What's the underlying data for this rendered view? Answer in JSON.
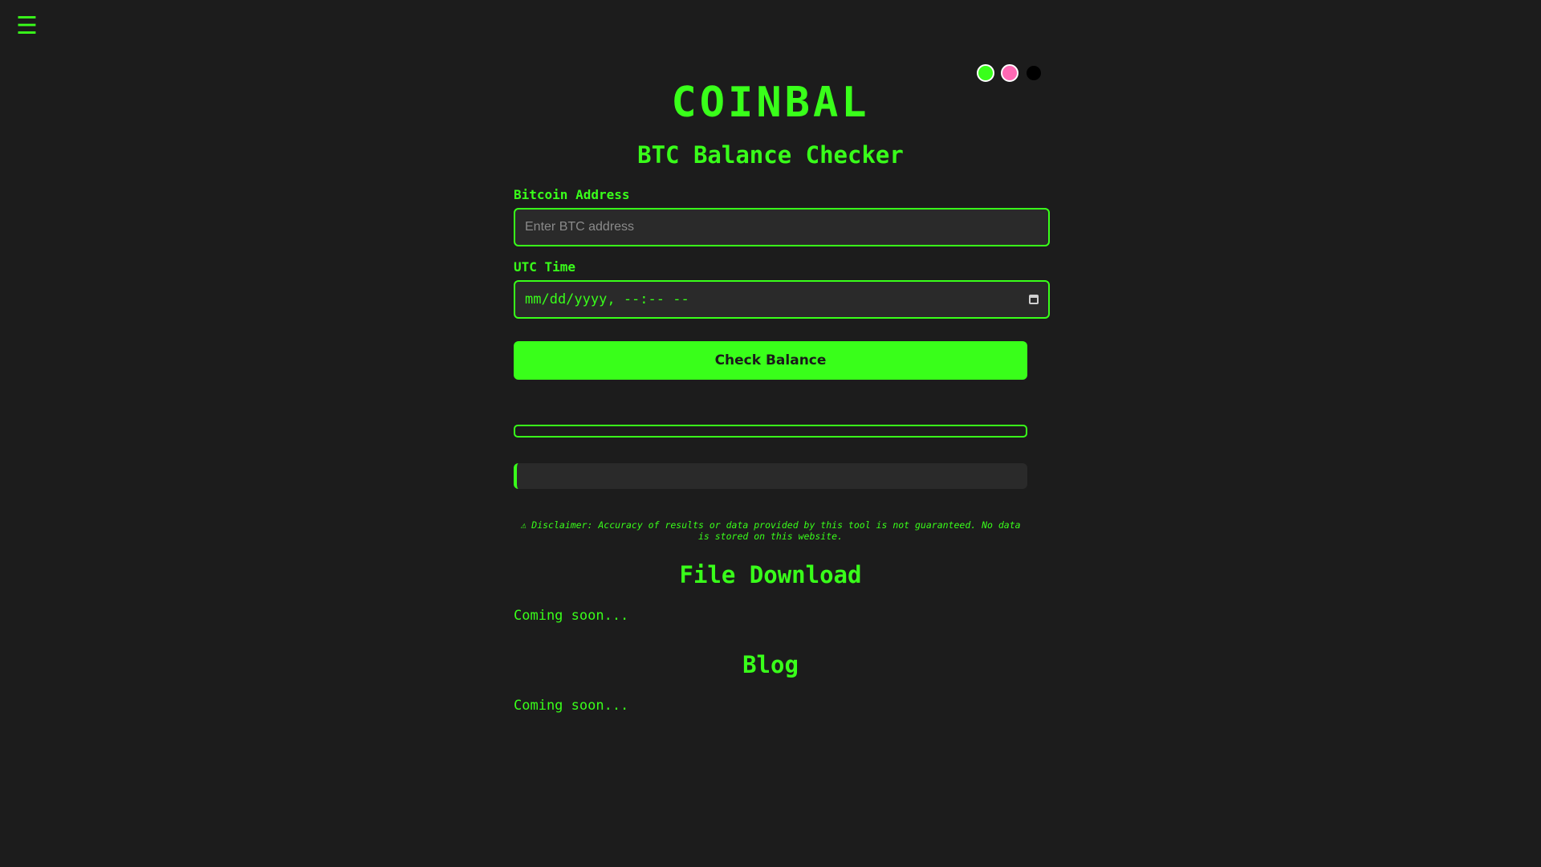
{
  "menu": {
    "icon": "hamburger-menu-icon",
    "glyph": "☰"
  },
  "themes": [
    {
      "name": "green",
      "color": "#39ff1a"
    },
    {
      "name": "pink",
      "color": "#ff69b4"
    },
    {
      "name": "black",
      "color": "#000000"
    }
  ],
  "header": {
    "brand": "COINBAL",
    "subtitle": "BTC Balance Checker"
  },
  "form": {
    "address_label": "Bitcoin Address",
    "address_placeholder": "Enter BTC address",
    "time_label": "UTC Time",
    "time_value": "mm/dd/yyyy, --:-- --",
    "submit_label": "Check Balance"
  },
  "progress": {
    "fraction": 0
  },
  "disclaimer": "⚠ Disclaimer: Accuracy of results or data provided by this tool is not guaranteed. No data is stored on this website.",
  "sections": {
    "download": {
      "title": "File Download",
      "body": "Coming soon..."
    },
    "blog": {
      "title": "Blog",
      "body": "Coming soon..."
    }
  },
  "colors": {
    "accent": "#39ff1a",
    "background": "#1c1c1c",
    "field_background": "#2a2a2a"
  }
}
